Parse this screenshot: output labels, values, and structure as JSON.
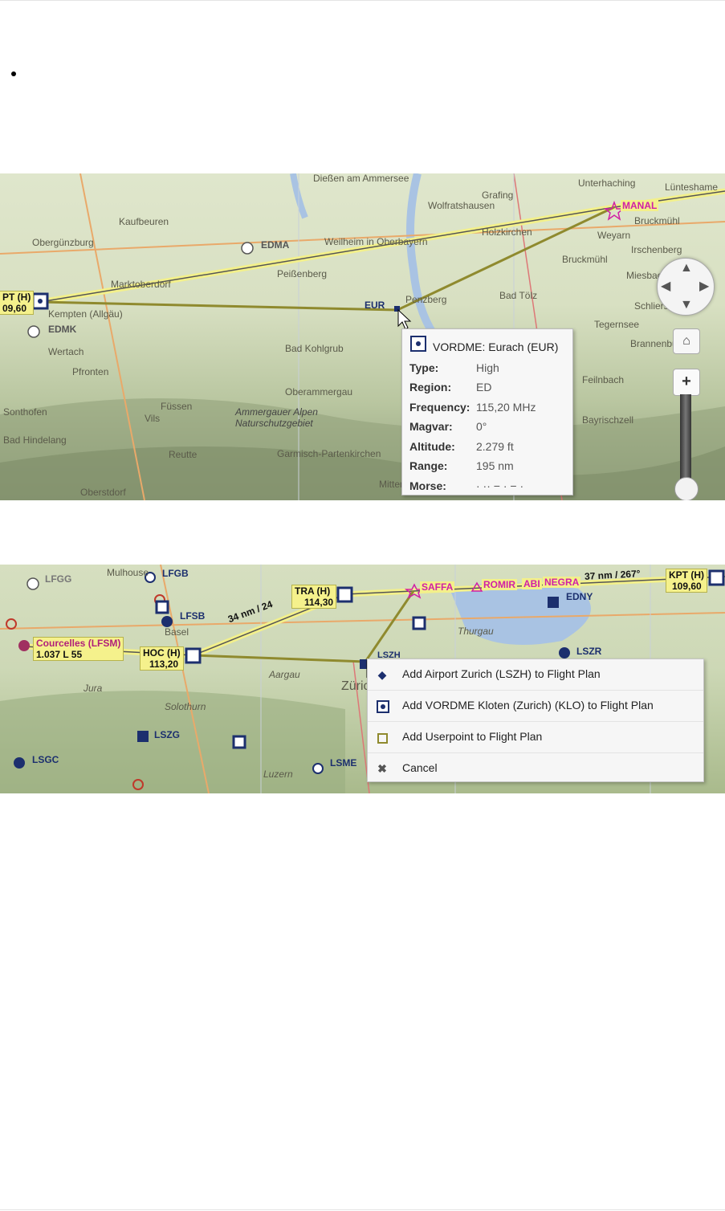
{
  "map1": {
    "place_labels": [
      "Dießen am Ammersee",
      "Kaufbeuren",
      "Obergünzburg",
      "Wolfratshausen",
      "Weilheim in Oberbayern",
      "Peißenberg",
      "Penzberg",
      "Bad Tölz",
      "Miesbach",
      "Irschenberg",
      "Weyarn",
      "Bruckmühl",
      "Schliersee",
      "Tegernsee",
      "Bad Kohlgrub",
      "Oberammergau",
      "Füssen",
      "Vils",
      "Reutte",
      "Garmisch-Partenkirchen",
      "Marktoberdorf",
      "Kempten (Allgäu)",
      "Holzkirchen",
      "Brannenburg",
      "Feilnbach",
      "Bayrischzell",
      "Mittenwald",
      "Ammergauer Alpen",
      "Naturschutzgebiet",
      "Pfronten",
      "Sonthofen",
      "Bad Hindelang",
      "Oberstdorf",
      "Wertach"
    ],
    "airport_codes": [
      "EDMA",
      "EDMK"
    ],
    "left_navaid": {
      "line1": "PT (H)",
      "line2": "09,60"
    },
    "eur_label": "EUR",
    "manal_label": "MANAL",
    "top_right_labels": [
      "Lünteshame",
      "Grafing",
      "Bruckmühl",
      "Unterhaching"
    ],
    "tooltip": {
      "title": "VORDME: Eurach (EUR)",
      "rows": [
        {
          "key": "Type:",
          "value": "High"
        },
        {
          "key": "Region:",
          "value": "ED"
        },
        {
          "key": "Frequency:",
          "value": "115,20 MHz"
        },
        {
          "key": "Magvar:",
          "value": "0°"
        },
        {
          "key": "Altitude:",
          "value": "2.279 ft"
        },
        {
          "key": "Range:",
          "value": "195 nm"
        },
        {
          "key": "Morse:",
          "value": "· ·· − · − ·"
        }
      ]
    }
  },
  "map2": {
    "airports": [
      "LFGG",
      "LFGB",
      "LFSB",
      "LSZG",
      "LSGC",
      "LSME",
      "LSZR",
      "EDNY",
      "LSZH"
    ],
    "navaids": [
      {
        "id": "tra",
        "line1": "TRA (H)",
        "line2": "114,30"
      },
      {
        "id": "hoc",
        "line1": "HOC (H)",
        "line2": "113,20"
      },
      {
        "id": "kpt",
        "line1": "KPT (H)",
        "line2": "109,60"
      },
      {
        "id": "courcelles",
        "line1": "Courcelles (LFSM)",
        "line2": "1.037 L 55"
      }
    ],
    "waypoints": [
      "SAFFA",
      "ROMIR",
      "ABI",
      "NEGRA"
    ],
    "leg_labels": [
      "34 nm / 24",
      "37 nm / 267°"
    ],
    "places": [
      "Mulhouse",
      "Basel",
      "Jura",
      "Solothurn",
      "Aargau",
      "Zürich",
      "Luzern",
      "Thurgau"
    ],
    "context_menu": [
      {
        "icon": "airport-icon",
        "label": "Add Airport Zurich (LSZH) to Flight Plan"
      },
      {
        "icon": "vordme-icon",
        "label": "Add VORDME Kloten (Zurich) (KLO) to Flight Plan"
      },
      {
        "icon": "userpoint-icon",
        "label": "Add Userpoint to Flight Plan"
      },
      {
        "icon": "cancel-icon",
        "label": "Cancel"
      }
    ]
  },
  "colors": {
    "route": "#8f8a2e",
    "route_highlight": "#f3f08a",
    "navaid": "#1c2f6e",
    "waypoint": "#d11fa5"
  }
}
